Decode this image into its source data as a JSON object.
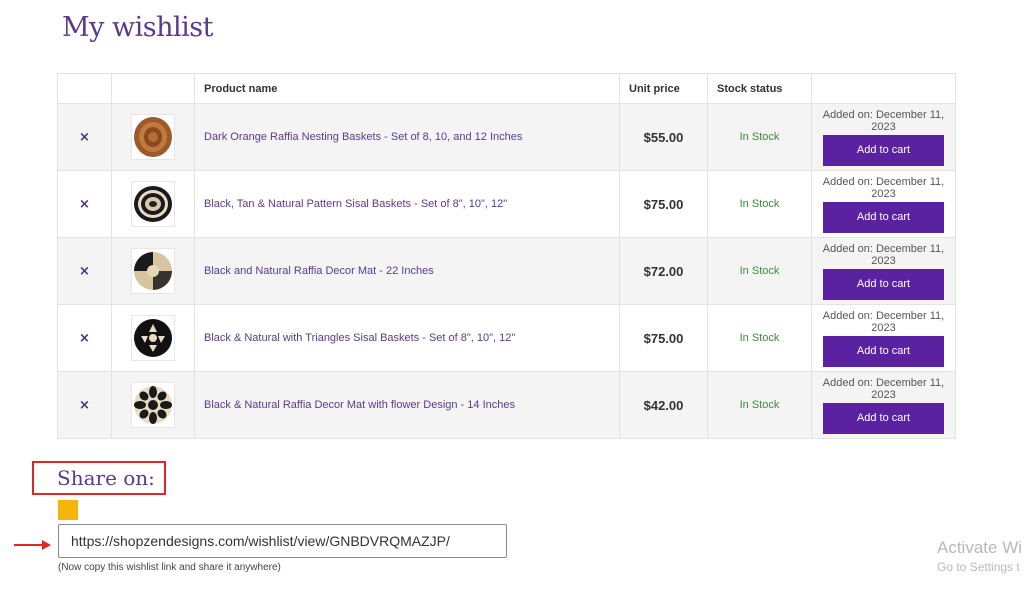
{
  "page": {
    "title": "My wishlist"
  },
  "table": {
    "headers": [
      "",
      "",
      "Product name",
      "Unit price",
      "Stock status",
      ""
    ],
    "rows": [
      {
        "remove": "×",
        "name": "Dark Orange Raffia Nesting Baskets - Set of 8, 10, and 12 Inches",
        "price": "$55.00",
        "stock": "In Stock",
        "added": "Added on: December 11, 2023",
        "button": "Add to cart"
      },
      {
        "remove": "×",
        "name": "Black, Tan & Natural Pattern Sisal Baskets - Set of 8\", 10\", 12\"",
        "price": "$75.00",
        "stock": "In Stock",
        "added": "Added on: December 11, 2023",
        "button": "Add to cart"
      },
      {
        "remove": "×",
        "name": "Black and Natural Raffia Decor Mat - 22 Inches",
        "price": "$72.00",
        "stock": "In Stock",
        "added": "Added on: December 11, 2023",
        "button": "Add to cart"
      },
      {
        "remove": "×",
        "name": "Black & Natural with Triangles Sisal Baskets - Set of 8\", 10\", 12\"",
        "price": "$75.00",
        "stock": "In Stock",
        "added": "Added on: December 11, 2023",
        "button": "Add to cart"
      },
      {
        "remove": "×",
        "name": "Black & Natural Raffia Decor Mat with flower Design - 14 Inches",
        "price": "$42.00",
        "stock": "In Stock",
        "added": "Added on: December 11, 2023",
        "button": "Add to cart"
      }
    ]
  },
  "share": {
    "title": "Share on:",
    "icon": "share-service-icon",
    "link": "https://shopzendesigns.com/wishlist/view/GNBDVRQMAZJP/",
    "hint": "(Now copy this wishlist link and share it anywhere)"
  },
  "watermark": {
    "line1": "Activate Wi",
    "line2": "Go to Settings t"
  },
  "colors": {
    "accent": "#5a22a0",
    "heading": "#5b3a8a",
    "stock": "#3b8a3b",
    "highlight": "#e0262c",
    "share_icon": "#f5b40c"
  }
}
